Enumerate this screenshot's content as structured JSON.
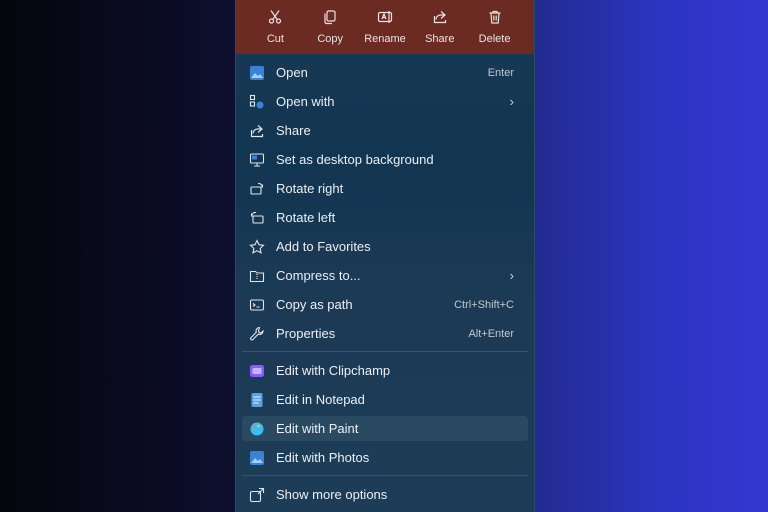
{
  "toolbar": {
    "items": [
      {
        "label": "Cut",
        "icon": "scissors-icon"
      },
      {
        "label": "Copy",
        "icon": "copy-icon"
      },
      {
        "label": "Rename",
        "icon": "rename-icon"
      },
      {
        "label": "Share",
        "icon": "share-icon"
      },
      {
        "label": "Delete",
        "icon": "trash-icon"
      }
    ]
  },
  "menu": {
    "items": [
      {
        "label": "Open",
        "shortcut": "Enter",
        "icon": "photos-app-icon"
      },
      {
        "label": "Open with",
        "submenu": "›",
        "icon": "open-with-icon"
      },
      {
        "label": "Share",
        "icon": "share-icon"
      },
      {
        "label": "Set as desktop background",
        "icon": "desktop-background-icon"
      },
      {
        "label": "Rotate right",
        "icon": "rotate-right-icon"
      },
      {
        "label": "Rotate left",
        "icon": "rotate-left-icon"
      },
      {
        "label": "Add to Favorites",
        "icon": "star-icon"
      },
      {
        "label": "Compress to...",
        "submenu": "›",
        "icon": "zip-folder-icon"
      },
      {
        "label": "Copy as path",
        "shortcut": "Ctrl+Shift+C",
        "icon": "copy-path-icon"
      },
      {
        "label": "Properties",
        "shortcut": "Alt+Enter",
        "icon": "wrench-icon"
      }
    ],
    "apps": [
      {
        "label": "Edit with Clipchamp",
        "icon": "clipchamp-icon"
      },
      {
        "label": "Edit in Notepad",
        "icon": "notepad-icon"
      },
      {
        "label": "Edit with Paint",
        "icon": "paint-icon"
      },
      {
        "label": "Edit with Photos",
        "icon": "photos-app-icon"
      }
    ],
    "more": {
      "label": "Show more options",
      "icon": "more-options-icon"
    }
  },
  "colors": {
    "toolbar_bg": "#6b2b22",
    "menu_bg": "#1a3a55",
    "hover_bg": "#2a4a62"
  }
}
